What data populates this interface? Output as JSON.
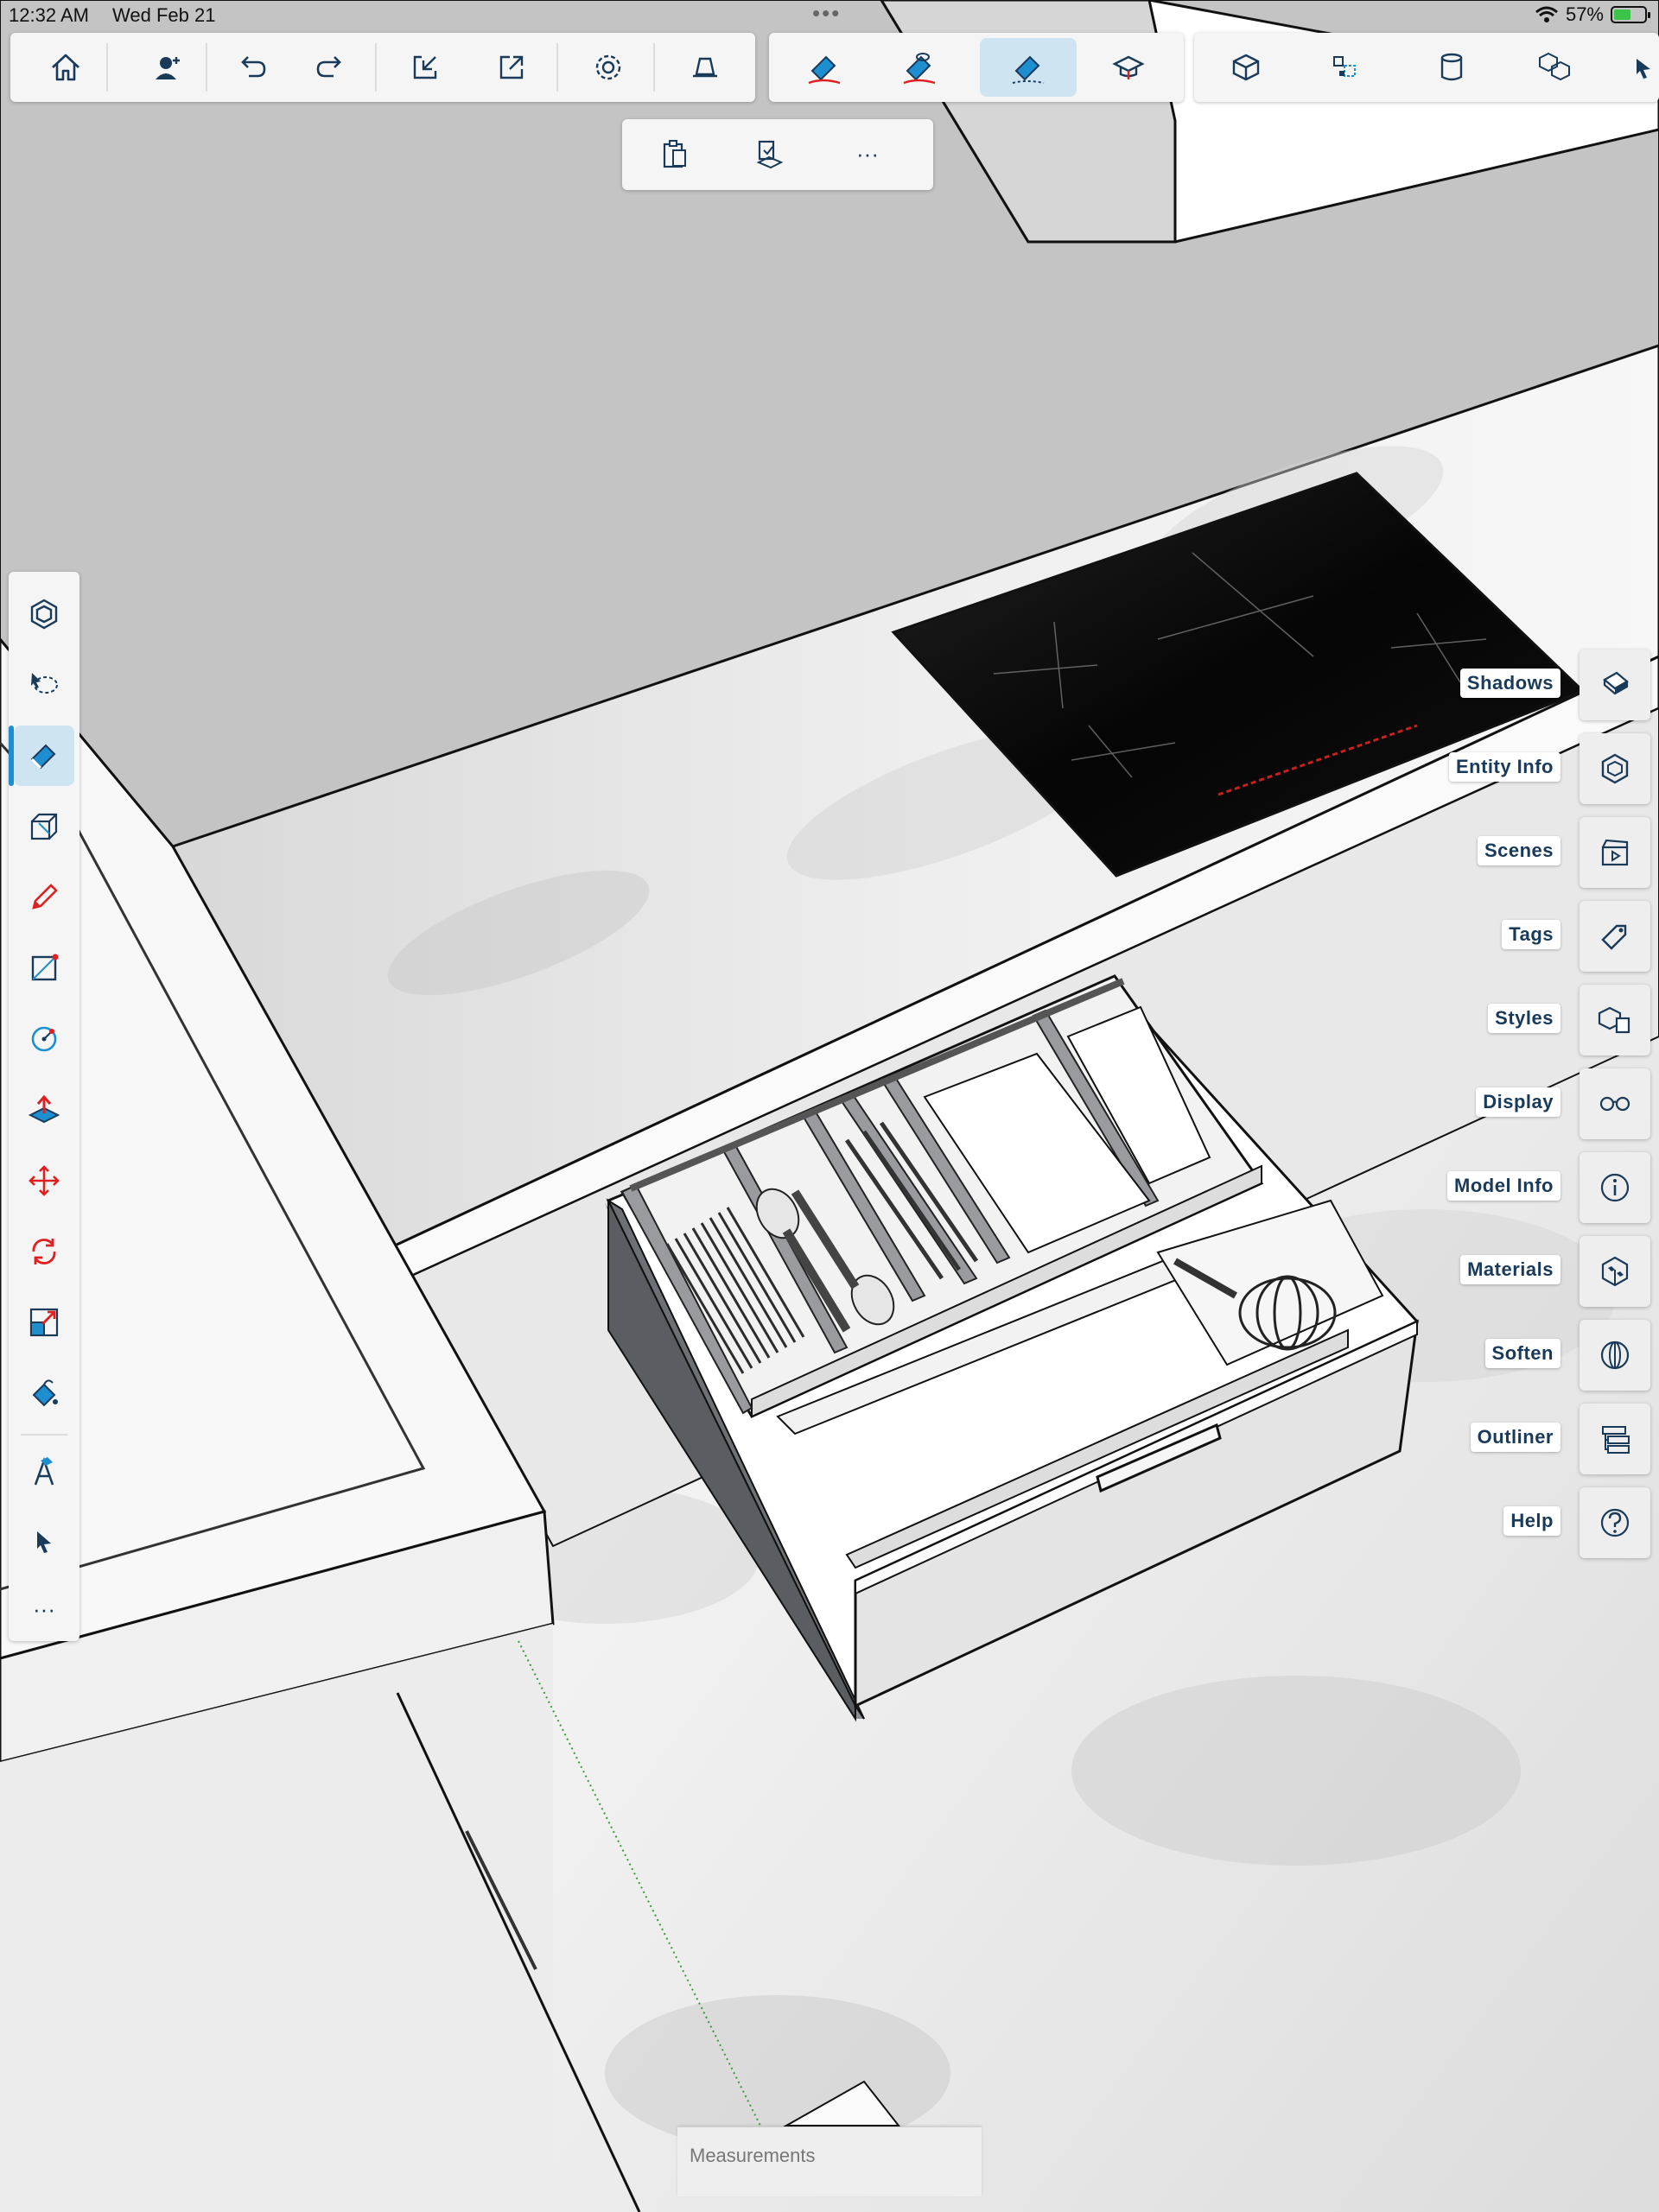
{
  "status_bar": {
    "time": "12:32 AM",
    "date": "Wed Feb 21",
    "battery_percent": "57%",
    "battery_level": 0.57,
    "dots": "•••"
  },
  "top_toolbar": {
    "group1": [
      {
        "icon": "home-icon"
      },
      {
        "icon": "add-user-icon"
      },
      {
        "icon": "undo-icon"
      },
      {
        "icon": "redo-icon"
      },
      {
        "icon": "import-icon"
      },
      {
        "icon": "export-icon"
      },
      {
        "icon": "gear-icon"
      },
      {
        "icon": "view-icon"
      }
    ],
    "group2": [
      {
        "icon": "eraser-delete-icon"
      },
      {
        "icon": "eraser-hide-icon"
      },
      {
        "icon": "eraser-soften-icon",
        "active": true
      },
      {
        "icon": "graduation-cap-icon"
      }
    ],
    "group3": [
      {
        "icon": "solid-cube-icon"
      },
      {
        "icon": "component-icon"
      },
      {
        "icon": "cylinder-icon"
      },
      {
        "icon": "cubes-icon"
      }
    ],
    "secondary": [
      {
        "icon": "clipboard-icon"
      },
      {
        "icon": "paste-in-place-icon"
      },
      {
        "icon": "more-icon",
        "label": "···"
      }
    ]
  },
  "left_toolbar": {
    "items": [
      {
        "icon": "layers-hex-icon"
      },
      {
        "icon": "lasso-select-icon"
      },
      {
        "icon": "eraser-icon",
        "active": true
      },
      {
        "icon": "box-icon"
      },
      {
        "icon": "pencil-icon"
      },
      {
        "icon": "rectangle-icon"
      },
      {
        "icon": "circle-icon"
      },
      {
        "icon": "push-pull-icon"
      },
      {
        "icon": "move-icon"
      },
      {
        "icon": "rotate-icon"
      },
      {
        "icon": "scale-icon"
      },
      {
        "icon": "paint-bucket-icon"
      },
      {
        "icon": "text-label-icon"
      },
      {
        "icon": "select-arrow-icon"
      },
      {
        "icon": "more-icon",
        "label": "···"
      }
    ]
  },
  "right_panel": {
    "items": [
      {
        "label": "Shadows",
        "icon": "shadows-icon"
      },
      {
        "label": "Entity Info",
        "icon": "entity-info-icon"
      },
      {
        "label": "Scenes",
        "icon": "scenes-icon"
      },
      {
        "label": "Tags",
        "icon": "tag-icon"
      },
      {
        "label": "Styles",
        "icon": "styles-icon"
      },
      {
        "label": "Display",
        "icon": "glasses-icon"
      },
      {
        "label": "Model Info",
        "icon": "info-icon"
      },
      {
        "label": "Materials",
        "icon": "materials-icon"
      },
      {
        "label": "Soften",
        "icon": "soften-icon"
      },
      {
        "label": "Outliner",
        "icon": "outliner-icon"
      },
      {
        "label": "Help",
        "icon": "help-icon"
      }
    ]
  },
  "measurements": {
    "placeholder": "Measurements"
  },
  "colors": {
    "accent": "#1d8fd0",
    "active_bg": "#cfe4f1",
    "icon": "#1a3a5a",
    "icon_red": "#e02020"
  }
}
